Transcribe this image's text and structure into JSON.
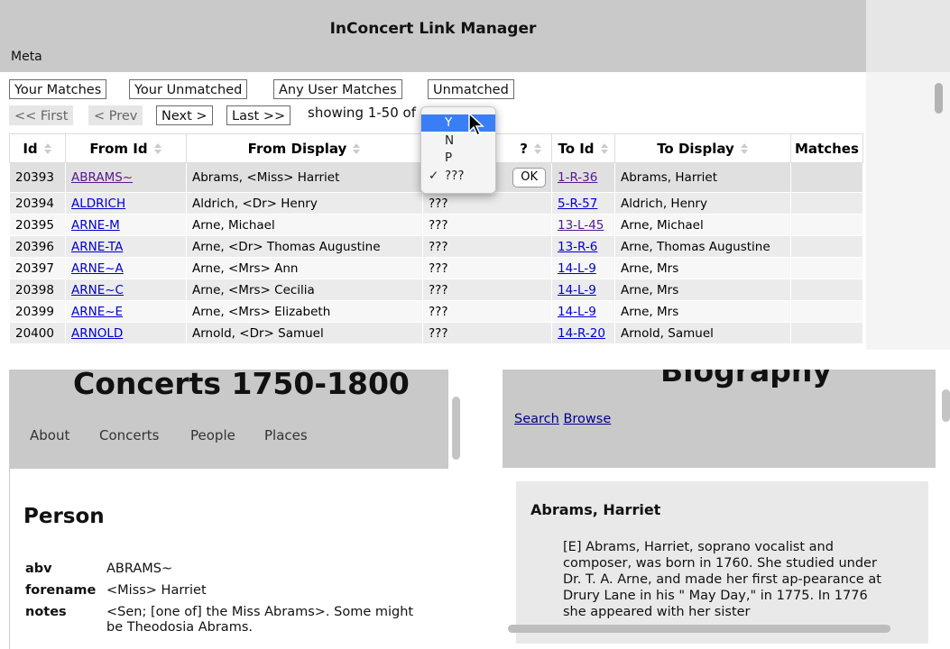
{
  "app": {
    "title": "InConcert Link Manager",
    "meta_label": "Meta"
  },
  "filter_tabs": [
    "Your Matches",
    "Your Unmatched",
    "Any User Matches",
    "Unmatched"
  ],
  "pager": {
    "first": "<< First",
    "prev": "< Prev",
    "next": "Next >",
    "last": "Last >>",
    "showing": "showing 1-50 of"
  },
  "table": {
    "headers": [
      "Id",
      "From Id",
      "From Display",
      "?",
      "To Id",
      "To Display",
      "Matches"
    ],
    "rows": [
      {
        "id": "20393",
        "from_id": "ABRAMS~",
        "from_display": "Abrams, <Miss> Harriet",
        "match": "",
        "to_id": "1-R-36",
        "to_display": "Abrams, Harriet"
      },
      {
        "id": "20394",
        "from_id": "ALDRICH",
        "from_display": "Aldrich, <Dr> Henry",
        "match": "???",
        "to_id": "5-R-57",
        "to_display": "Aldrich, Henry"
      },
      {
        "id": "20395",
        "from_id": "ARNE-M",
        "from_display": "Arne, Michael",
        "match": "???",
        "to_id": "13-L-45",
        "to_display": "Arne, Michael"
      },
      {
        "id": "20396",
        "from_id": "ARNE-TA",
        "from_display": "Arne, <Dr> Thomas Augustine",
        "match": "???",
        "to_id": "13-R-6",
        "to_display": "Arne, Thomas Augustine"
      },
      {
        "id": "20397",
        "from_id": "ARNE~A",
        "from_display": "Arne, <Mrs> Ann",
        "match": "???",
        "to_id": "14-L-9",
        "to_display": "Arne, Mrs"
      },
      {
        "id": "20398",
        "from_id": "ARNE~C",
        "from_display": "Arne, <Mrs> Cecilia",
        "match": "???",
        "to_id": "14-L-9",
        "to_display": "Arne, Mrs"
      },
      {
        "id": "20399",
        "from_id": "ARNE~E",
        "from_display": "Arne, <Mrs> Elizabeth",
        "match": "???",
        "to_id": "14-L-9",
        "to_display": "Arne, Mrs"
      },
      {
        "id": "20400",
        "from_id": "ARNOLD",
        "from_display": "Arnold, <Dr> Samuel",
        "match": "???",
        "to_id": "14-R-20",
        "to_display": "Arnold, Samuel"
      }
    ],
    "ok_label": "OK"
  },
  "dropdown": {
    "options": [
      "Y",
      "N",
      "P",
      "???"
    ],
    "highlighted": "Y",
    "checked": "???"
  },
  "left_pane": {
    "site_title": "Concerts 1750-1800",
    "nav": [
      "About",
      "Concerts",
      "People",
      "Places"
    ],
    "heading": "Person",
    "props": [
      {
        "key": "abv",
        "value": "ABRAMS~"
      },
      {
        "key": "forename",
        "value": "<Miss> Harriet"
      },
      {
        "key": "notes",
        "value": "<Sen; [one of] the Miss Abrams>. Some might be Theodosia Abrams."
      }
    ]
  },
  "right_pane": {
    "title": "Biography",
    "links": [
      "Search",
      "Browse"
    ],
    "entry_name": "Abrams, Harriet",
    "entry_text": "[E] Abrams, Harriet, soprano vocalist and composer, was born in 1760. She studied under Dr. T. A. Arne, and made her first ap-pearance at Drury Lane in his \" May Day,\" in 1775. In 1776 she appeared with her sister"
  },
  "colors": {
    "header_bg": "#c9c9c9",
    "link": "#0000cc",
    "highlight": "#3a7ef5"
  }
}
